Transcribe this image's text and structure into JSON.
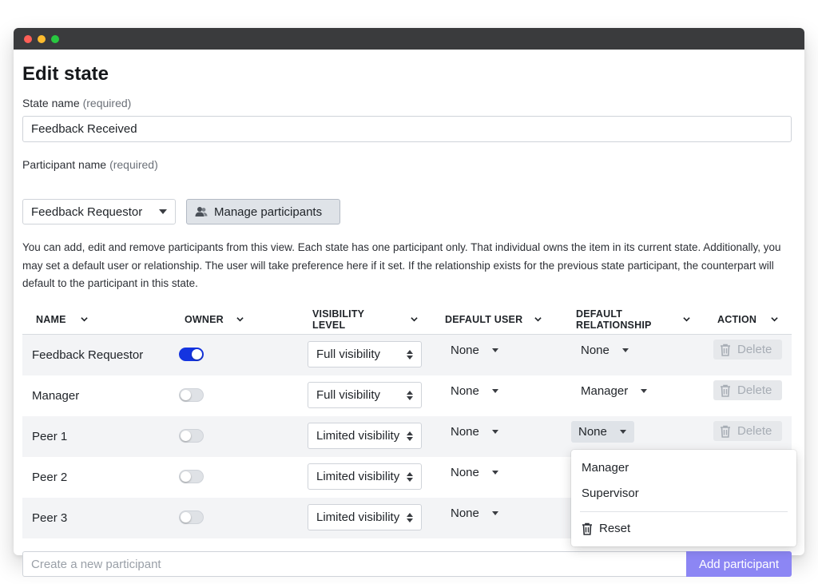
{
  "page": {
    "title": "Edit state",
    "state_name_label": "State name",
    "state_name_required": "(required)",
    "state_name_value": "Feedback Received",
    "participant_label": "Participant name",
    "participant_required": "(required)",
    "participant_selected": "Feedback Requestor",
    "manage_button": "Manage participants",
    "description": "You can add, edit and remove participants from this view. Each state has one participant only. That individual owns the item in its current state. Additionally, you may set a default user or relationship. The user will take preference here if it set. If the relationship exists for the previous state participant, the counterpart will default to the participant in this state."
  },
  "table": {
    "headers": {
      "name": "NAME",
      "owner": "OWNER",
      "visibility_1": "VISIBILITY",
      "visibility_2": "LEVEL",
      "default_user": "DEFAULT USER",
      "relationship_1": "DEFAULT",
      "relationship_2": "RELATIONSHIP",
      "action": "ACTION"
    },
    "rows": [
      {
        "name": "Feedback Requestor",
        "owner": true,
        "visibility": "Full visibility",
        "default_user": "None",
        "relationship": "None",
        "action": "Delete"
      },
      {
        "name": "Manager",
        "owner": false,
        "visibility": "Full visibility",
        "default_user": "None",
        "relationship": "Manager",
        "action": "Delete"
      },
      {
        "name": "Peer 1",
        "owner": false,
        "visibility": "Limited visibility",
        "default_user": "None",
        "relationship": "None",
        "action": "Delete"
      },
      {
        "name": "Peer 2",
        "owner": false,
        "visibility": "Limited visibility",
        "default_user": "None"
      },
      {
        "name": "Peer 3",
        "owner": false,
        "visibility": "Limited visibility",
        "default_user": "None"
      }
    ]
  },
  "relationship_menu": {
    "items": [
      "Manager",
      "Supervisor"
    ],
    "reset": "Reset"
  },
  "new_participant": {
    "placeholder": "Create a new participant",
    "button": "Add participant"
  },
  "colors": {
    "accent": "#1434e0",
    "add_button": "#8c86f4",
    "titlebar": "#3a3b3d"
  }
}
